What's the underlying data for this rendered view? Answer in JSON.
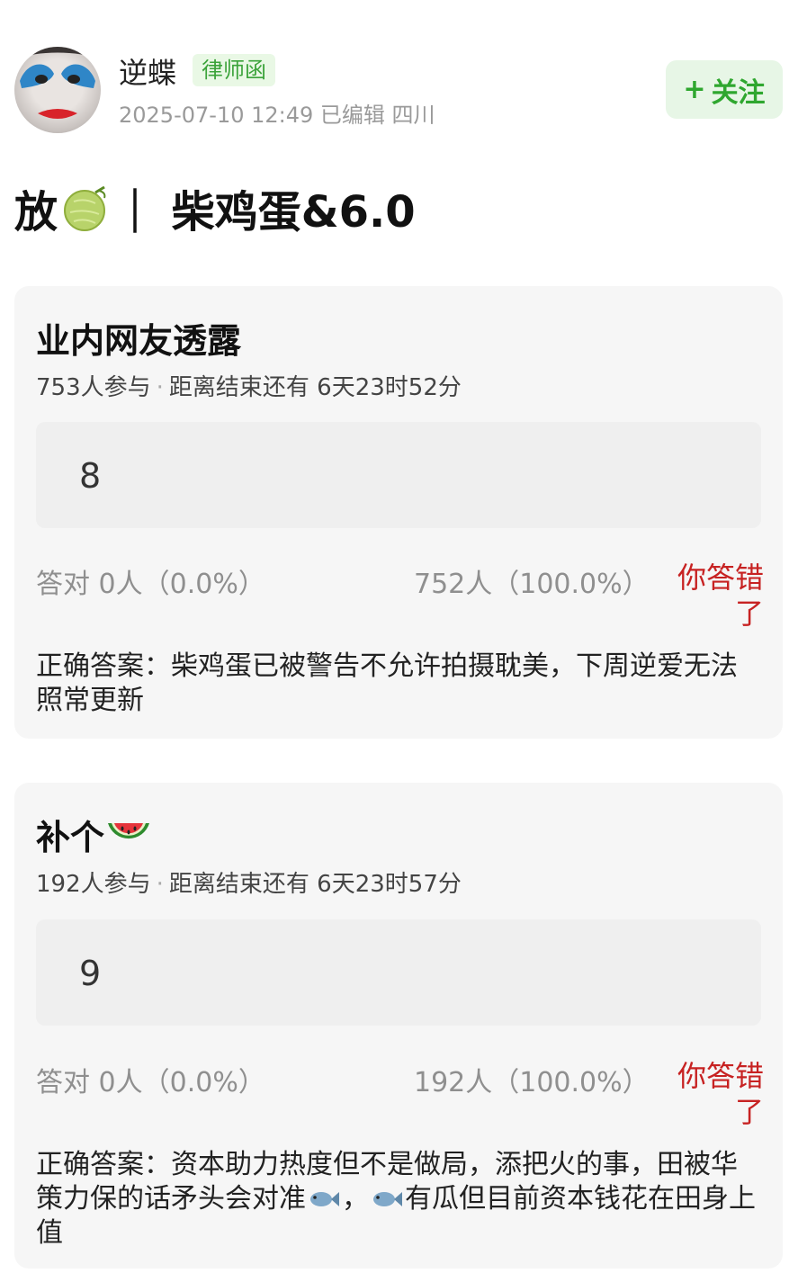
{
  "header": {
    "username": "逆蝶",
    "badge": "律师函",
    "meta": "2025-07-10 12:49  已编辑  四川",
    "follow_label": "关注",
    "follow_plus": "+"
  },
  "post": {
    "title_prefix": "放",
    "title_suffix": "｜ 柴鸡蛋&6.0",
    "title_icon": "melon-icon"
  },
  "quizzes": [
    {
      "title": "业内网友透露",
      "participants": "753人参与",
      "separator": "·",
      "time_left": "距离结束还有 6天23时52分",
      "answer": "8",
      "correct_label": "答对  0人（0.0%）",
      "wrong_count": "752人（100.0%）",
      "result": "你答错了",
      "correct_answer": "正确答案：柴鸡蛋已被警告不允许拍摄耽美，下周逆爱无法照常更新"
    },
    {
      "title": "补个",
      "title_icon": "watermelon-icon",
      "participants": "192人参与",
      "separator": "·",
      "time_left": "距离结束还有 6天23时57分",
      "answer": "9",
      "correct_label": "答对  0人（0.0%）",
      "wrong_count": "192人（100.0%）",
      "result": "你答错了",
      "correct_answer_1": "正确答案：资本助力热度但不是做局，添把火的事，田被华策力保的话矛头会对准",
      "correct_answer_2": "，",
      "correct_answer_3": "有瓜但目前资本钱花在田身上值"
    }
  ],
  "colors": {
    "accent_green": "#2fa72f",
    "badge_green": "#3ba33a",
    "wrong_red": "#c72222"
  }
}
